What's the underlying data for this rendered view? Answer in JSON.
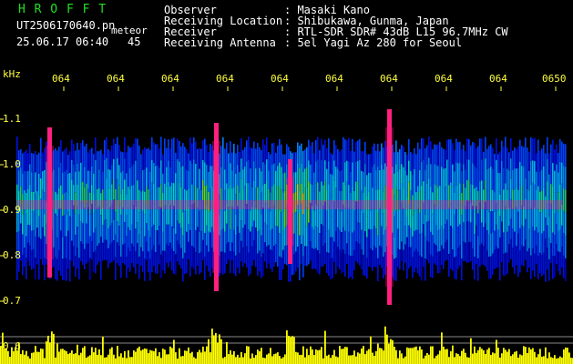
{
  "header": {
    "app_name": "H R O F F T",
    "filename": "UT2506170640.pn",
    "meteor_label": "meteor",
    "datetime": "25.06.17 06:40",
    "count": "45",
    "info_labels": [
      "Observer",
      "Receiving Location",
      "Receiver",
      "Receiving Antenna"
    ],
    "info_values": [
      ": Masaki Kano",
      ": Shibukawa, Gunma, Japan",
      ": RTL-SDR SDR# 43dB L15 96.7MHz CW",
      ": 5el Yagi Az 280 for Seoul"
    ]
  },
  "axes": {
    "y_unit": "kHz",
    "y_ticks": [
      "1.1",
      "1.0",
      "0.9",
      "0.8",
      "0.7",
      "0.6"
    ],
    "x_ticks": [
      "064",
      "064",
      "064",
      "064",
      "064",
      "064",
      "064",
      "064",
      "064",
      "0650"
    ]
  },
  "colors": {
    "header_green": "#20e020",
    "header_white": "#ffffff",
    "axis_yellow": "#ffff40",
    "background": "#000000"
  }
}
